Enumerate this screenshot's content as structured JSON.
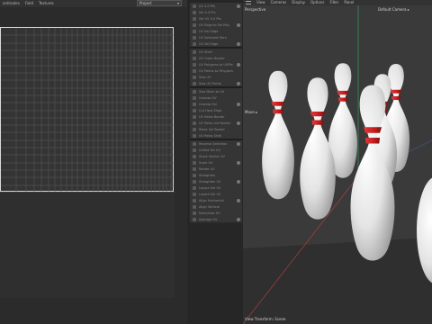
{
  "uv_editor": {
    "menu": [
      "ordinates",
      "Field",
      "Textures"
    ],
    "projection_select": "Project"
  },
  "tool_palette": {
    "items": [
      "UV 4-0 Pts",
      "Sel 4-0 Pts",
      "Sel UV 4-0 Pts",
      "UV Edge to Sel Poly",
      "UV Sel Edge",
      "UV Selected Pairs",
      "UV Sel Edge",
      "UV Shell",
      "UV Outer Border",
      "UV Polygons to UVPts",
      "UV Points to Polygons",
      "Sew UV",
      "Sew UV Points",
      "Sew Mesh to UV",
      "Unwrap UV",
      "Unwrap Sel",
      "Cut Hard Edge",
      "UV Relax Border",
      "UV Relax Ind Border",
      "Relax Sel Border",
      "UV Relax Shell",
      "Reverse Selection",
      "Unfold Sel UV",
      "Stack Similar UV",
      "Scale UV",
      "Rotate UV",
      "Straighten",
      "Straighten UV",
      "Layout Sel UV",
      "Layout Sel UV",
      "Align Horizontal",
      "Align Vertical",
      "Normalize UV",
      "Average UV"
    ]
  },
  "viewport": {
    "menu": [
      "View",
      "Cameras",
      "Display",
      "Options",
      "Filter",
      "Panel"
    ],
    "view_name": "Perspective",
    "camera_name": "Default Camera",
    "side_label": "Move",
    "status_text": "View Transform: Scene",
    "colors": {
      "background": "#3a3a3a",
      "floor": "#2f2f2f",
      "pin_white": "#e6e6e6",
      "pin_stripe": "#c21d1d",
      "axis_green": "#3aa86a",
      "axis_red": "#b94343"
    }
  }
}
